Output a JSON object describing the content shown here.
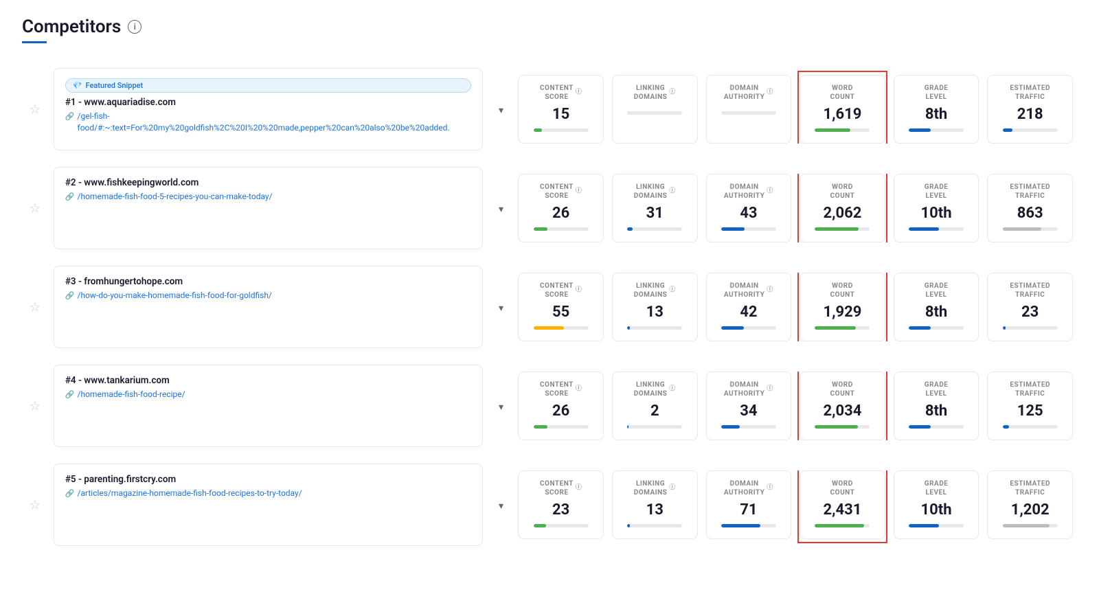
{
  "page": {
    "title": "Competitors",
    "title_underline_color": "#1565c0"
  },
  "columns": {
    "content_score": "CONTENT SCORE",
    "linking_domains": "LINKING DOMAINS",
    "domain_authority": "DOMAIN AUTHORITY",
    "word_count": "WORD COUNT",
    "grade_level": "GRADE LEVEL",
    "estimated_traffic": "ESTIMATED TRAFFIC"
  },
  "competitors": [
    {
      "rank": "#1",
      "domain": "www.aquariadise.com",
      "url": "/gel-fish-food/#:~:text=For%20my%20goldfish%2C%20I%20%20made,pepper%20can%20also%20be%20added.",
      "has_featured_snippet": true,
      "featured_snippet_label": "Featured Snippet",
      "content_score": 15,
      "content_score_bar": 15,
      "content_score_bar_color": "bar-green",
      "linking_domains": null,
      "linking_domains_bar": 0,
      "linking_domains_bar_color": "bar-blue",
      "domain_authority": null,
      "domain_authority_bar": 0,
      "domain_authority_bar_color": "bar-blue",
      "word_count": 1619,
      "word_count_bar": 65,
      "word_count_bar_color": "bar-green",
      "grade_level": "8th",
      "grade_level_bar": 40,
      "grade_level_bar_color": "bar-blue",
      "estimated_traffic": 218,
      "estimated_traffic_bar": 18,
      "estimated_traffic_bar_color": "bar-blue"
    },
    {
      "rank": "#2",
      "domain": "www.fishkeepingworld.com",
      "url": "/homemade-fish-food-5-recipes-you-can-make-today/",
      "has_featured_snippet": false,
      "featured_snippet_label": "",
      "content_score": 26,
      "content_score_bar": 26,
      "content_score_bar_color": "bar-green",
      "linking_domains": 31,
      "linking_domains_bar": 10,
      "linking_domains_bar_color": "bar-blue",
      "domain_authority": 43,
      "domain_authority_bar": 43,
      "domain_authority_bar_color": "bar-blue",
      "word_count": 2062,
      "word_count_bar": 80,
      "word_count_bar_color": "bar-green",
      "grade_level": "10th",
      "grade_level_bar": 55,
      "grade_level_bar_color": "bar-blue",
      "estimated_traffic": 863,
      "estimated_traffic_bar": 70,
      "estimated_traffic_bar_color": "bar-gray"
    },
    {
      "rank": "#3",
      "domain": "fromhungertohope.com",
      "url": "/how-do-you-make-homemade-fish-food-for-goldfish/",
      "has_featured_snippet": false,
      "featured_snippet_label": "",
      "content_score": 55,
      "content_score_bar": 55,
      "content_score_bar_color": "bar-yellow",
      "linking_domains": 13,
      "linking_domains_bar": 5,
      "linking_domains_bar_color": "bar-blue",
      "domain_authority": 42,
      "domain_authority_bar": 42,
      "domain_authority_bar_color": "bar-blue",
      "word_count": 1929,
      "word_count_bar": 75,
      "word_count_bar_color": "bar-green",
      "grade_level": "8th",
      "grade_level_bar": 40,
      "grade_level_bar_color": "bar-blue",
      "estimated_traffic": 23,
      "estimated_traffic_bar": 5,
      "estimated_traffic_bar_color": "bar-blue"
    },
    {
      "rank": "#4",
      "domain": "www.tankarium.com",
      "url": "/homemade-fish-food-recipe/",
      "has_featured_snippet": false,
      "featured_snippet_label": "",
      "content_score": 26,
      "content_score_bar": 26,
      "content_score_bar_color": "bar-green",
      "linking_domains": 2,
      "linking_domains_bar": 2,
      "linking_domains_bar_color": "bar-blue",
      "domain_authority": 34,
      "domain_authority_bar": 34,
      "domain_authority_bar_color": "bar-blue",
      "word_count": 2034,
      "word_count_bar": 78,
      "word_count_bar_color": "bar-green",
      "grade_level": "8th",
      "grade_level_bar": 40,
      "grade_level_bar_color": "bar-blue",
      "estimated_traffic": 125,
      "estimated_traffic_bar": 12,
      "estimated_traffic_bar_color": "bar-blue"
    },
    {
      "rank": "#5",
      "domain": "parenting.firstcry.com",
      "url": "/articles/magazine-homemade-fish-food-recipes-to-try-today/",
      "has_featured_snippet": false,
      "featured_snippet_label": "",
      "content_score": 23,
      "content_score_bar": 23,
      "content_score_bar_color": "bar-green",
      "linking_domains": 13,
      "linking_domains_bar": 5,
      "linking_domains_bar_color": "bar-blue",
      "domain_authority": 71,
      "domain_authority_bar": 71,
      "domain_authority_bar_color": "bar-blue",
      "word_count": 2431,
      "word_count_bar": 90,
      "word_count_bar_color": "bar-green",
      "grade_level": "10th",
      "grade_level_bar": 55,
      "grade_level_bar_color": "bar-blue",
      "estimated_traffic": 1202,
      "estimated_traffic_bar": 85,
      "estimated_traffic_bar_color": "bar-gray"
    }
  ]
}
